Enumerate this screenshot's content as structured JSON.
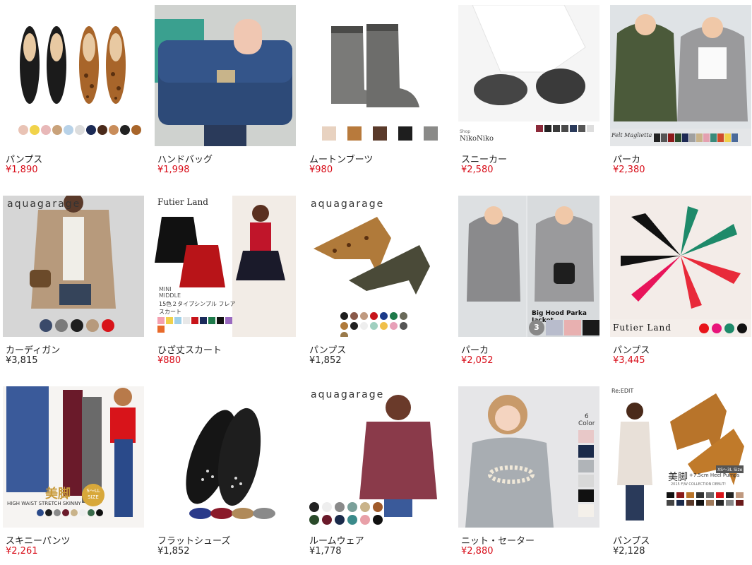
{
  "products": [
    {
      "name": "パンプス",
      "price": "¥1,890",
      "sale": true
    },
    {
      "name": "ハンドバッグ",
      "price": "¥1,998",
      "sale": true
    },
    {
      "name": "ムートンブーツ",
      "price": "¥980",
      "sale": true
    },
    {
      "name": "スニーカー",
      "price": "¥2,580",
      "sale": true
    },
    {
      "name": "パーカ",
      "price": "¥2,380",
      "sale": true
    },
    {
      "name": "カーディガン",
      "price": "¥3,815",
      "sale": false
    },
    {
      "name": "ひざ丈スカート",
      "price": "¥880",
      "sale": true
    },
    {
      "name": "パンプス",
      "price": "¥1,852",
      "sale": false
    },
    {
      "name": "パーカ",
      "price": "¥2,052",
      "sale": true
    },
    {
      "name": "パンプス",
      "price": "¥3,445",
      "sale": true
    },
    {
      "name": "スキニーパンツ",
      "price": "¥2,261",
      "sale": true
    },
    {
      "name": "フラットシューズ",
      "price": "¥1,852",
      "sale": false
    },
    {
      "name": "ルームウェア",
      "price": "¥1,778",
      "sale": false
    },
    {
      "name": "ニット・セーター",
      "price": "¥2,880",
      "sale": true
    },
    {
      "name": "パンプス",
      "price": "¥2,128",
      "sale": false
    }
  ],
  "thumb_text": {
    "niko_shop": "Shop",
    "niko": "NikoNiko",
    "felt": "Felt Maglietta",
    "aquagarage": "aquagarage",
    "futier": "Futier Land",
    "mini_middle": "MINI\nMIDDLE",
    "skirt_caption": "15色２タイプシンプル フレアスカート",
    "bighood": "Big Hood Parka Jacket",
    "three_color": "3",
    "futier_big": "Futier Land",
    "bikyaku": "美脚",
    "highwaist": "HIGH WAIST STRETCH SKINNY",
    "size_sll": "S〜LL SIZE",
    "six_color": "6\nColor",
    "re_edit": "Re:EDIT",
    "heel_title": "美脚",
    "heel_sub": "+7.5cm Heel Pumps",
    "heel_size": "XS〜3L Size",
    "collection": "2015 F/W COLLECTION DEBUT!"
  },
  "colors": {
    "sale_red": "#d80c18",
    "text": "#222222"
  }
}
